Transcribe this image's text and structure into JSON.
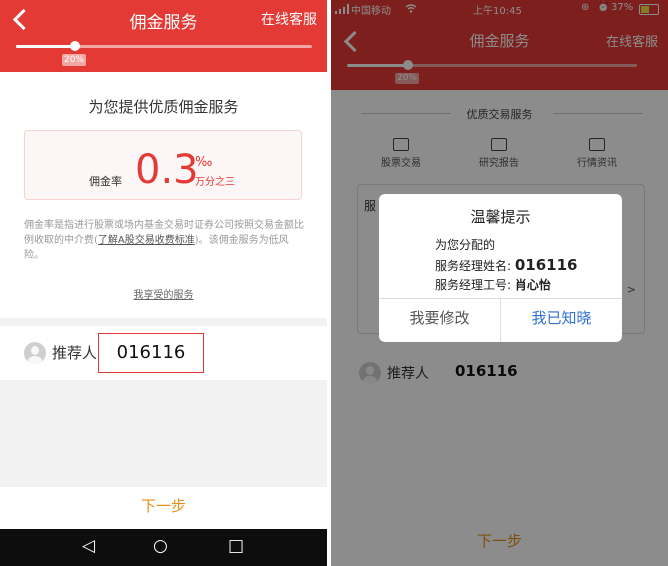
{
  "left": {
    "header": {
      "title": "佣金服务",
      "service_link": "在线客服"
    },
    "progress": {
      "percent": 20,
      "label": "20%"
    },
    "intro": {
      "heading": "为您提供优质佣金服务",
      "rate_label": "佣金率",
      "rate_value": "0.3",
      "rate_unit_symbol": "‰",
      "rate_unit_text": "万分之三",
      "desc_before": "佣金率是指进行股票或场内基金交易时证券公司按照交易金额比例收取的中介费(",
      "desc_link": "了解A股交易收费标准",
      "desc_after": ")。该佣金服务为低风险。",
      "my_service_link": "我享受的服务"
    },
    "referrer": {
      "label": "推荐人",
      "value": "016116"
    },
    "next_label": "下一步",
    "nav": {
      "back": "◁",
      "home": "○",
      "recent": "□"
    }
  },
  "right": {
    "statusbar": {
      "carrier": "中国移动",
      "time": "上午10:45",
      "battery": "37%"
    },
    "header": {
      "title": "佣金服务",
      "service_link": "在线客服"
    },
    "progress": {
      "percent": 20,
      "label": "20%"
    },
    "section_title": "优质交易服务",
    "features": [
      "股票交易",
      "研究报告",
      "行情资讯"
    ],
    "box_char": "服",
    "box_arrow": ">",
    "referrer": {
      "label": "推荐人",
      "value": "016116"
    },
    "next_label": "下一步",
    "dialog": {
      "title": "温馨提示",
      "line1": "为您分配的",
      "manager_name_label": "服务经理姓名:",
      "manager_name_value": "016116",
      "manager_id_label": "服务经理工号:",
      "manager_id_value": "肖心怡",
      "modify_button": "我要修改",
      "confirm_button": "我已知晓"
    }
  },
  "colors": {
    "brand_red": "#e33a35",
    "next_orange": "#e3901a",
    "link_blue": "#2f6fd6"
  }
}
